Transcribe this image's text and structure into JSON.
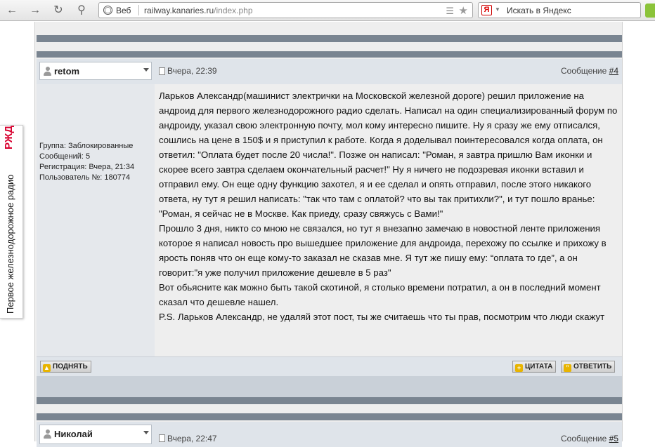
{
  "browser": {
    "address_label": "Веб",
    "url_host": "railway.kanaries.ru",
    "url_path": "/index.php",
    "search_placeholder": "Искать в Яндекс",
    "search_engine_icon": "Я"
  },
  "side_tab": {
    "logo": "РЖД",
    "text": "Первое железнодорожное радио"
  },
  "posts": [
    {
      "author": "retom",
      "date": "Вчера, 22:39",
      "message_label": "Сообщение ",
      "message_number": "#4",
      "info": {
        "group": "Группа: Заблокированные",
        "messages": "Сообщений: 5",
        "registration": "Регистрация: Вчера, 21:34",
        "user_number": "Пользователь №: 180774"
      },
      "paragraphs": [
        "Ларьков Александр(машинист электрички на Московской железной дороге) решил приложение на андроид для первого железнодорожного радио сделать. Написал на один специализированный форум по андроиду, указал свою электронную почту, мол кому интересно пишите. Ну я сразу же ему отписался, сошлись на цене в 150$ и я приступил к работе. Когда я доделывал поинтересовался когда оплата, он ответил: \"Оплата будет после 20 числа!\". Позже он написал: \"Роман, я завтра пришлю Вам иконки и скорее всего завтра сделаем окончательный расчет!\" Ну я ничего не подозревая иконки вставил и отправил ему. Он еще одну функцию захотел, я и ее сделал и опять отправил, после этого никакого ответа, ну тут я решил написать: \"так что там с оплатой? что вы так притихли?\", и тут пошло вранье: \"Роман, я сейчас не в Москве. Как приеду, сразу свяжусь с Вами!\"",
        "Прошло 3 дня, никто со мною не связался, но тут я внезапно замечаю в новостной ленте приложения которое я написал новость про вышедшее приложение для андроида, перехожу по ссылке и прихожу в ярость поняв что он еще кому-то заказал не сказав мне. Я тут же пишу ему: “оплата то где”, а он говорит:\"я уже получил приложение дешевле в 5 раз\"",
        "Вот обьясните как можно быть такой скотиной, я столько времени потратил, а он в последний момент сказал что дешевле нашел.",
        "P.S. Ларьков Александр, не удаляй этот пост, ты же считаешь что ты прав, посмотрим что люди скажут"
      ],
      "buttons": {
        "up": "ПОДНЯТЬ",
        "quote": "ЦИТАТА",
        "reply": "ОТВЕТИТЬ"
      }
    },
    {
      "author": "Николай",
      "date": "Вчера, 22:47",
      "message_label": "Сообщение ",
      "message_number": "#5"
    }
  ]
}
